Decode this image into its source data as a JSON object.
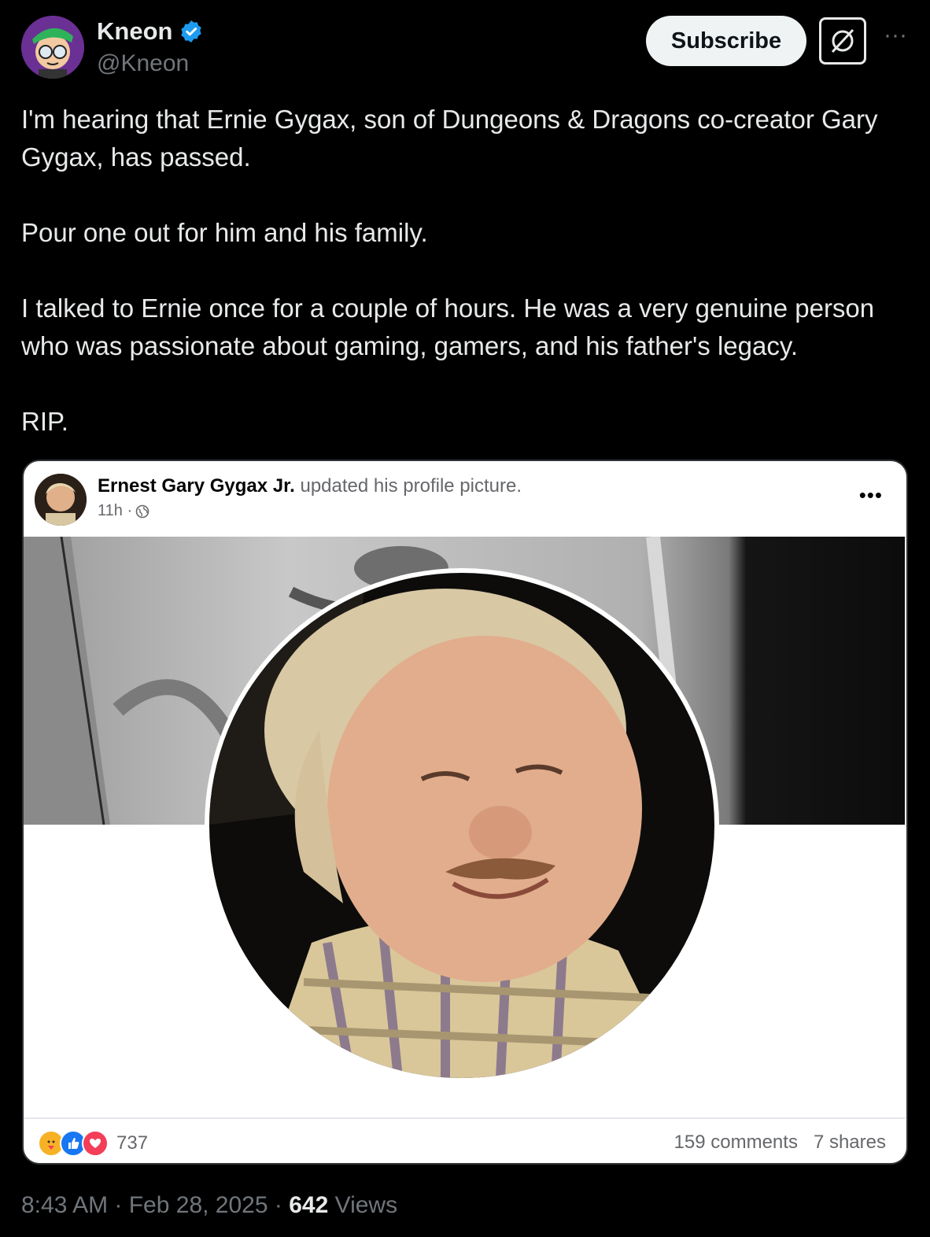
{
  "author": {
    "display_name": "Kneon",
    "handle": "@Kneon",
    "verified_icon": "verified-badge-icon",
    "avatar_icon": "cartoon-avatar"
  },
  "actions": {
    "subscribe_label": "Subscribe",
    "grok_icon": "grok-icon",
    "more_icon": "more-dots-icon"
  },
  "tweet": {
    "paragraphs": [
      "I'm hearing that Ernie Gygax, son of Dungeons & Dragons co-creator Gary Gygax, has passed.",
      "Pour one out for him and his family.",
      "I talked to Ernie once for a couple of hours. He was a very genuine person who was passionate about gaming, gamers, and his father's legacy.",
      "RIP."
    ]
  },
  "embedded_post": {
    "name": "Ernest Gary Gygax Jr.",
    "action": "updated his profile picture.",
    "time": "11h ·",
    "reactions_count": "737",
    "comments": "159 comments",
    "shares": "7 shares"
  },
  "footer": {
    "time": "8:43 AM · Feb 28, 2025 · ",
    "views_count": "642",
    "views_label": " Views"
  },
  "colors": {
    "background": "#000000",
    "text": "#e7e9ea",
    "muted": "#71767b",
    "verified": "#1d9bf0"
  }
}
